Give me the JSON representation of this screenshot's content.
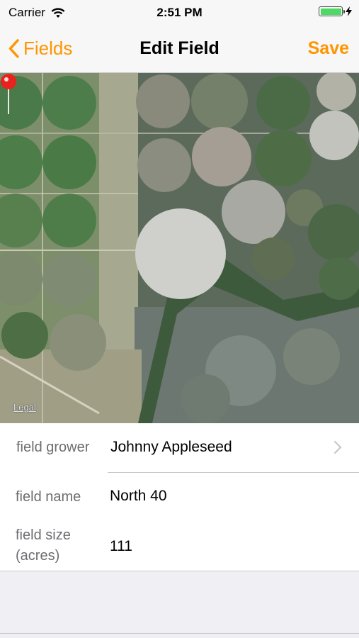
{
  "status_bar": {
    "carrier": "Carrier",
    "time": "2:51 PM",
    "wifi_icon": "wifi-icon",
    "battery_icon": "battery-full-icon",
    "charging_icon": "bolt-icon"
  },
  "nav": {
    "back_label": "Fields",
    "title": "Edit Field",
    "save_label": "Save",
    "accent_color": "#ff9500"
  },
  "map": {
    "legal_label": "Legal",
    "pin_icon": "map-pin-icon",
    "pin_color": "#e8221c"
  },
  "form": {
    "grower": {
      "label": "field grower",
      "value": "Johnny Appleseed"
    },
    "name": {
      "label": "field name",
      "value": "North 40"
    },
    "size": {
      "label": "field size (acres)",
      "value": "111"
    }
  }
}
